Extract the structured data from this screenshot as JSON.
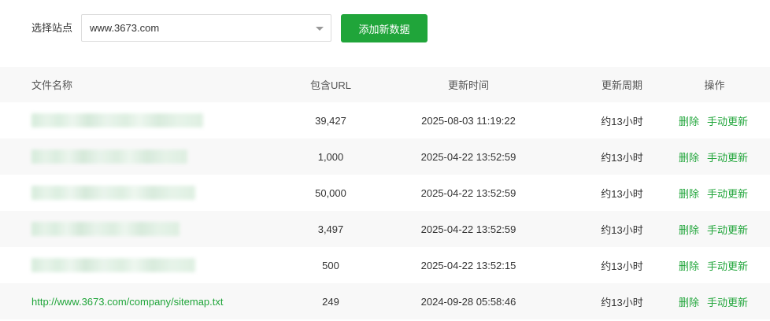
{
  "toolbar": {
    "site_label": "选择站点",
    "site_value": "www.3673.com",
    "add_button_label": "添加新数据"
  },
  "table": {
    "headers": {
      "name": "文件名称",
      "url_count": "包含URL",
      "update_time": "更新时间",
      "update_cycle": "更新周期",
      "actions": "操作"
    },
    "rows": [
      {
        "name": "",
        "name_blurred": true,
        "url_count": "39,427",
        "update_time": "2025-08-03 11:19:22",
        "update_cycle": "约13小时",
        "delete_label": "删除",
        "manual_update_label": "手动更新"
      },
      {
        "name": "",
        "name_blurred": true,
        "url_count": "1,000",
        "update_time": "2025-04-22 13:52:59",
        "update_cycle": "约13小时",
        "delete_label": "删除",
        "manual_update_label": "手动更新"
      },
      {
        "name": "",
        "name_blurred": true,
        "url_count": "50,000",
        "update_time": "2025-04-22 13:52:59",
        "update_cycle": "约13小时",
        "delete_label": "删除",
        "manual_update_label": "手动更新"
      },
      {
        "name": "",
        "name_blurred": true,
        "url_count": "3,497",
        "update_time": "2025-04-22 13:52:59",
        "update_cycle": "约13小时",
        "delete_label": "删除",
        "manual_update_label": "手动更新"
      },
      {
        "name": "",
        "name_blurred": true,
        "url_count": "500",
        "update_time": "2025-04-22 13:52:15",
        "update_cycle": "约13小时",
        "delete_label": "删除",
        "manual_update_label": "手动更新"
      },
      {
        "name": "http://www.3673.com/company/sitemap.txt",
        "name_blurred": false,
        "url_count": "249",
        "update_time": "2024-09-28 05:58:46",
        "update_cycle": "约13小时",
        "delete_label": "删除",
        "manual_update_label": "手动更新"
      }
    ]
  },
  "colors": {
    "accent": "#20a53a",
    "header_bg": "#f8f8f8",
    "stripe_bg": "#f8f8f8"
  },
  "icons": {
    "select_caret": "caret-down-icon"
  }
}
